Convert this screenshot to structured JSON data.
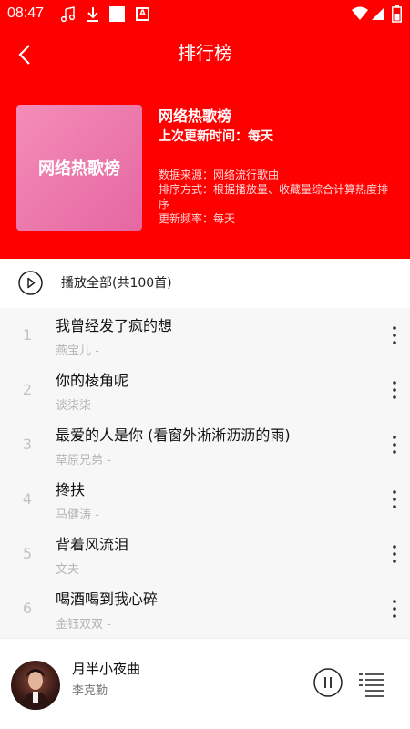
{
  "status_bar": {
    "time": "08:47"
  },
  "header": {
    "title": "排行榜",
    "cover_label": "网络热歌榜",
    "playlist_name": "网络热歌榜",
    "update_info": "上次更新时间：每天",
    "meta_source": "数据来源：网络流行歌曲",
    "meta_sort": "排序方式：根据播放量、收藏量综合计算热度排序",
    "meta_frequency": "更新频率：每天"
  },
  "play_all": {
    "label": "播放全部(共100首)"
  },
  "songs": [
    {
      "index": "1",
      "title": "我曾经发了疯的想",
      "artist": "燕宝儿 -"
    },
    {
      "index": "2",
      "title": "你的棱角呢",
      "artist": "谈柒柒 -"
    },
    {
      "index": "3",
      "title": "最爱的人是你 (看窗外淅淅沥沥的雨)",
      "artist": "草原兄弟 -"
    },
    {
      "index": "4",
      "title": "搀扶",
      "artist": "马健涛 -"
    },
    {
      "index": "5",
      "title": "背着风流泪",
      "artist": "文夫 -"
    },
    {
      "index": "6",
      "title": "喝酒喝到我心碎",
      "artist": "金钰双双 -"
    }
  ],
  "player": {
    "title": "月半小夜曲",
    "artist": "李克勤"
  },
  "colors": {
    "accent": "#ff0000",
    "cover": "#ec75ab",
    "list_bg": "#f7f7f7"
  },
  "icons": [
    "back-arrow-icon",
    "play-circle-icon",
    "more-vertical-icon",
    "pause-circle-icon",
    "playlist-icon"
  ]
}
